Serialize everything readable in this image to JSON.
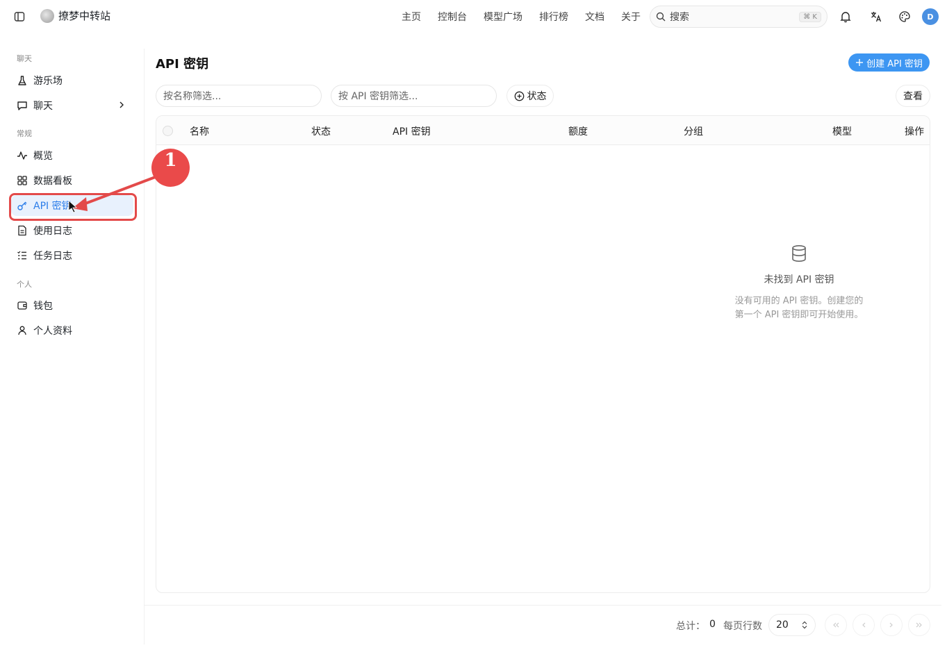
{
  "brand": {
    "name": "撩梦中转站"
  },
  "nav": [
    "主页",
    "控制台",
    "模型广场",
    "排行榜",
    "文档",
    "关于"
  ],
  "search": {
    "placeholder": "搜索",
    "shortcut": "⌘ K"
  },
  "user": {
    "avatar_letter": "D"
  },
  "sidebar": {
    "groups": [
      {
        "title": "聊天",
        "items": [
          {
            "label": "游乐场",
            "icon": "flask-icon"
          },
          {
            "label": "聊天",
            "icon": "chat-icon"
          }
        ]
      },
      {
        "title": "常规",
        "items": [
          {
            "label": "概览",
            "icon": "activity-icon"
          },
          {
            "label": "数据看板",
            "icon": "dashboard-icon"
          },
          {
            "label": "API 密钥",
            "icon": "key-icon",
            "active": true
          },
          {
            "label": "使用日志",
            "icon": "document-icon"
          },
          {
            "label": "任务日志",
            "icon": "list-icon"
          }
        ]
      },
      {
        "title": "个人",
        "items": [
          {
            "label": "钱包",
            "icon": "wallet-icon"
          },
          {
            "label": "个人资料",
            "icon": "user-icon"
          }
        ]
      }
    ]
  },
  "page": {
    "title": "API 密钥",
    "create_button": "创建 API 密钥",
    "filter_name_placeholder": "按名称筛选...",
    "filter_key_placeholder": "按 API 密钥筛选...",
    "status_button": "状态",
    "view_button": "查看"
  },
  "table": {
    "columns": [
      "名称",
      "状态",
      "API 密钥",
      "额度",
      "分组",
      "模型",
      "操作"
    ],
    "empty_title": "未找到 API 密钥",
    "empty_desc_line1": "没有可用的 API 密钥。创建您的",
    "empty_desc_line2": "第一个 API 密钥即可开始使用。"
  },
  "footer": {
    "total_label": "总计：",
    "total_value": "0",
    "per_page_label": "每页行数",
    "per_page_value": "20"
  },
  "annotation": {
    "step": "1",
    "color": "#e34a4a"
  }
}
